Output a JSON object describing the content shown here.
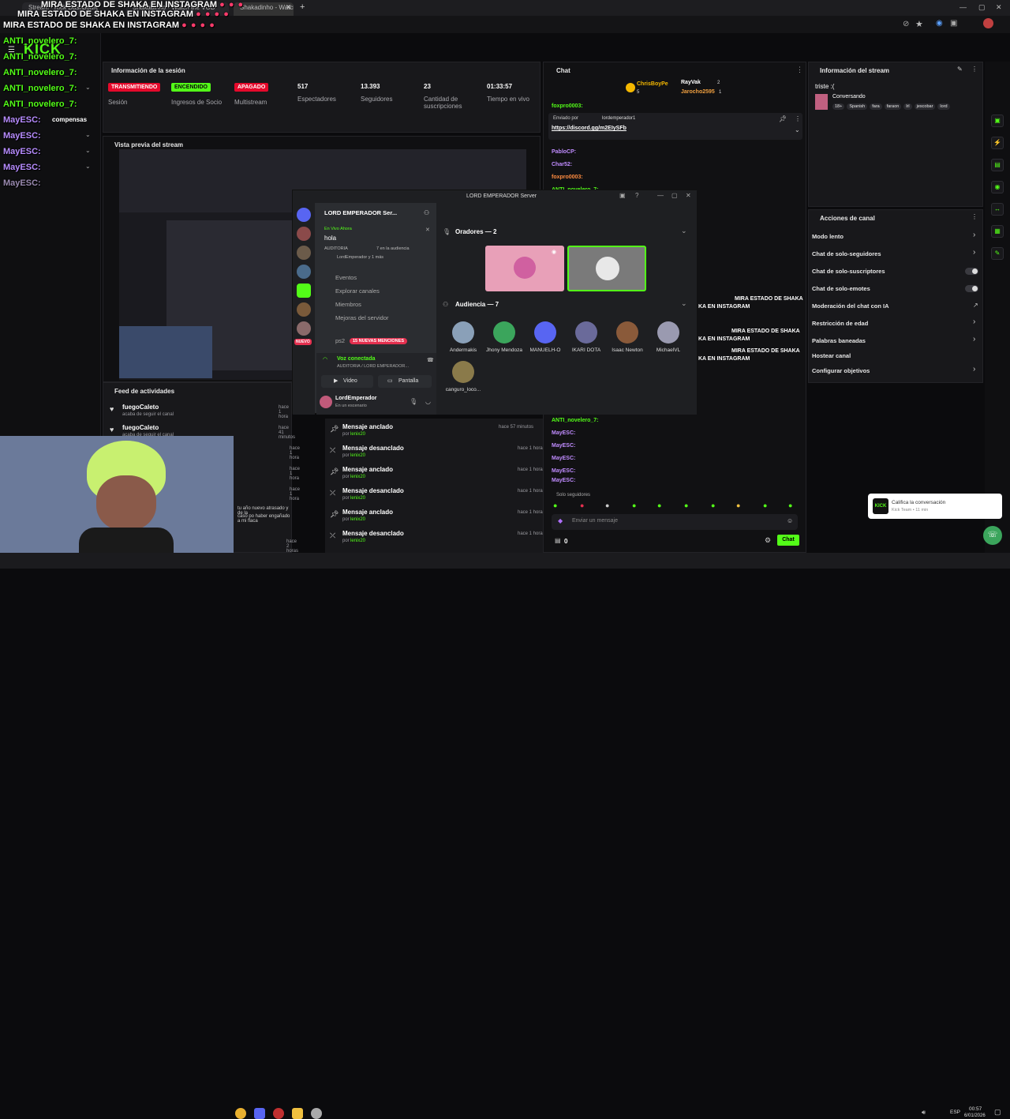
{
  "browser": {
    "tabs": [
      "Stream - Kick Dashboard",
      "Shakadinho - Watch the VOD",
      "Shakadinho - Watch the VOD on"
    ]
  },
  "overlay": {
    "lines": [
      "MIRA ESTADO DE SHAKA EN INSTAGRAM",
      "MIRA ESTADO DE SHAKA EN INSTAGRAM",
      "MIRA ESTADO DE SHAKA EN INSTAGRAM"
    ],
    "chat": [
      {
        "name": "ANTI_novelero_7:",
        "color": "green"
      },
      {
        "name": "ANTI_novelero_7:",
        "color": "green"
      },
      {
        "name": "ANTI_novelero_7:",
        "color": "green"
      },
      {
        "name": "ANTI_novelero_7:",
        "color": "green"
      },
      {
        "name": "ANTI_novelero_7:",
        "color": "green"
      },
      {
        "name": "MayESC:",
        "color": "purple"
      },
      {
        "name": "MayESC:",
        "color": "purple"
      },
      {
        "name": "MayESC:",
        "color": "purple"
      },
      {
        "name": "MayESC:",
        "color": "purple"
      },
      {
        "name": "MayESC:",
        "color": "purple"
      }
    ],
    "compensas": "compensas"
  },
  "logo": "KICK",
  "session": {
    "title": "Información de la sesión",
    "stats": [
      {
        "badge": "TRANSMITIENDO",
        "label": "Sesión",
        "badge_color": "#e5092b"
      },
      {
        "badge": "ENCENDIDO",
        "label": "Ingresos de Socio",
        "badge_color": "#53fc18"
      },
      {
        "badge": "APAGADO",
        "label": "Multistream",
        "badge_color": "#e5092b"
      },
      {
        "value": "517",
        "label": "Espectadores"
      },
      {
        "value": "13.393",
        "label": "Seguidores"
      },
      {
        "value": "23",
        "label": "Cantidad de suscripciones"
      },
      {
        "value": "01:33:57",
        "label": "Tiempo en vivo"
      }
    ]
  },
  "preview": {
    "title": "Vista previa del stream"
  },
  "feed": {
    "title": "Feed de actividades",
    "items": [
      {
        "user": "fuegoCaleto",
        "action": "acaba de seguir el canal",
        "time": "hace 1 hora"
      },
      {
        "user": "fuegoCaleto",
        "action": "acaba de seguir el canal",
        "time": "hace 41 minutos"
      },
      {
        "user": "",
        "action": "",
        "time": "hace 1 hora"
      },
      {
        "user": "",
        "action": "",
        "time": "hace 1 hora"
      },
      {
        "user": "",
        "action": "",
        "time": "hace 1 hora"
      },
      {
        "user": "",
        "action": "",
        "time": "hace 2 horas"
      }
    ],
    "snippet1": "tu año nuevo atrasado y de la",
    "snippet2": "caso po haber engañado a mi flaca"
  },
  "pinned": [
    {
      "title": "Mensaje anclado",
      "by": "por",
      "user": "lenix20",
      "time": "hace 57 minutos"
    },
    {
      "title": "Mensaje desanclado",
      "by": "por",
      "user": "lenix20",
      "time": "hace 1 hora"
    },
    {
      "title": "Mensaje anclado",
      "by": "por",
      "user": "lenix20",
      "time": "hace 1 hora"
    },
    {
      "title": "Mensaje desanclado",
      "by": "por",
      "user": "lenix20",
      "time": "hace 1 hora"
    },
    {
      "title": "Mensaje anclado",
      "by": "por",
      "user": "lenix20",
      "time": "hace 1 hora"
    },
    {
      "title": "Mensaje desanclado",
      "by": "por",
      "user": "lenix20",
      "time": "hace 1 hora"
    }
  ],
  "discord": {
    "window_title": "LORD EMPERADOR Server",
    "server_name": "LORD EMPERADOR Ser...",
    "live_label": "En Vivo Ahora",
    "stage_topic": "hola",
    "stage_meta": "AUDITORIA",
    "stage_audience": "7 en la audiencia",
    "stage_user": "LordEmperador y 1 más",
    "channels": [
      "Eventos",
      "Explorar canales",
      "Miembros",
      "Mejoras del servidor"
    ],
    "ps2": "ps2",
    "mentions": "15 NUEVAS MENCIONES",
    "nuevo": "NUEVO",
    "voice_connected": "Voz conectada",
    "voice_channel": "AUDITORIA / LORD EMPERADOR...",
    "video_btn": "Video",
    "screen_btn": "Pantalla",
    "username": "LordEmperador",
    "user_status": "En un escenario",
    "speakers": "Oradores — 2",
    "audience": "Audiencia — 7",
    "audience_members": [
      "Andermakis",
      "Jhony Mendoza",
      "MANUELH-O",
      "IKARI DOTA",
      "Isaac Newton",
      "MichaelVL",
      "canguro_loco..."
    ]
  },
  "chat": {
    "title": "Chat",
    "top": [
      {
        "name": "ChrisBoyPe",
        "count": "5"
      },
      {
        "name": "RayVak",
        "count": "2"
      },
      {
        "name": "Jarocho2595",
        "count": "1"
      }
    ],
    "pinned_by": "Enviado por",
    "pinned_user": "lordemperador1",
    "pinned_link": "https://discord.gg/m2EIySFb",
    "names": [
      "foxpro0003:",
      "PabloCP:",
      "Char52:",
      "foxpro0003:",
      "ANTI_novelero_7:"
    ],
    "banner_lines": [
      "MIRA ESTADO DE SHAKA",
      "KA EN INSTAGRAM",
      "MIRA ESTADO DE SHAKA",
      "KA EN INSTAGRAM",
      "MIRA ESTADO DE SHAKA",
      "KA EN INSTAGRAM"
    ],
    "bottom_names": [
      "ANTI_novelero_7:",
      "MayESC:",
      "MayESC:",
      "MayESC:",
      "MayESC:",
      "MayESC:"
    ],
    "followers_only": "Solo seguidores",
    "input_placeholder": "Enviar un mensaje",
    "count": "0",
    "send": "Chat"
  },
  "stream_info": {
    "title": "Información del stream",
    "stream_title": "triste :(",
    "category": "Conversando",
    "tags": [
      "18+",
      "Spanish",
      "fara",
      "faraon",
      "lrl",
      "jescobar",
      "lord"
    ]
  },
  "channel_actions": {
    "title": "Acciones de canal",
    "items": [
      {
        "label": "Modo lento",
        "kind": "chevron"
      },
      {
        "label": "Chat de solo-seguidores",
        "kind": "chevron"
      },
      {
        "label": "Chat de solo-suscriptores",
        "kind": "toggle"
      },
      {
        "label": "Chat de solo-emotes",
        "kind": "toggle"
      },
      {
        "label": "Moderación del chat con IA",
        "kind": "link"
      },
      {
        "label": "Restricción de edad",
        "kind": "chevron"
      },
      {
        "label": "Palabras baneadas",
        "kind": "chevron"
      },
      {
        "label": "Hostear canal",
        "kind": "none"
      },
      {
        "label": "Configurar objetivos",
        "kind": "chevron"
      }
    ]
  },
  "toast": {
    "title": "Califica la conversación",
    "sub": "Kick Team • 11 min"
  },
  "taskbar": {
    "lang": "ESP",
    "time": "00:57",
    "date": "6/01/2026"
  }
}
